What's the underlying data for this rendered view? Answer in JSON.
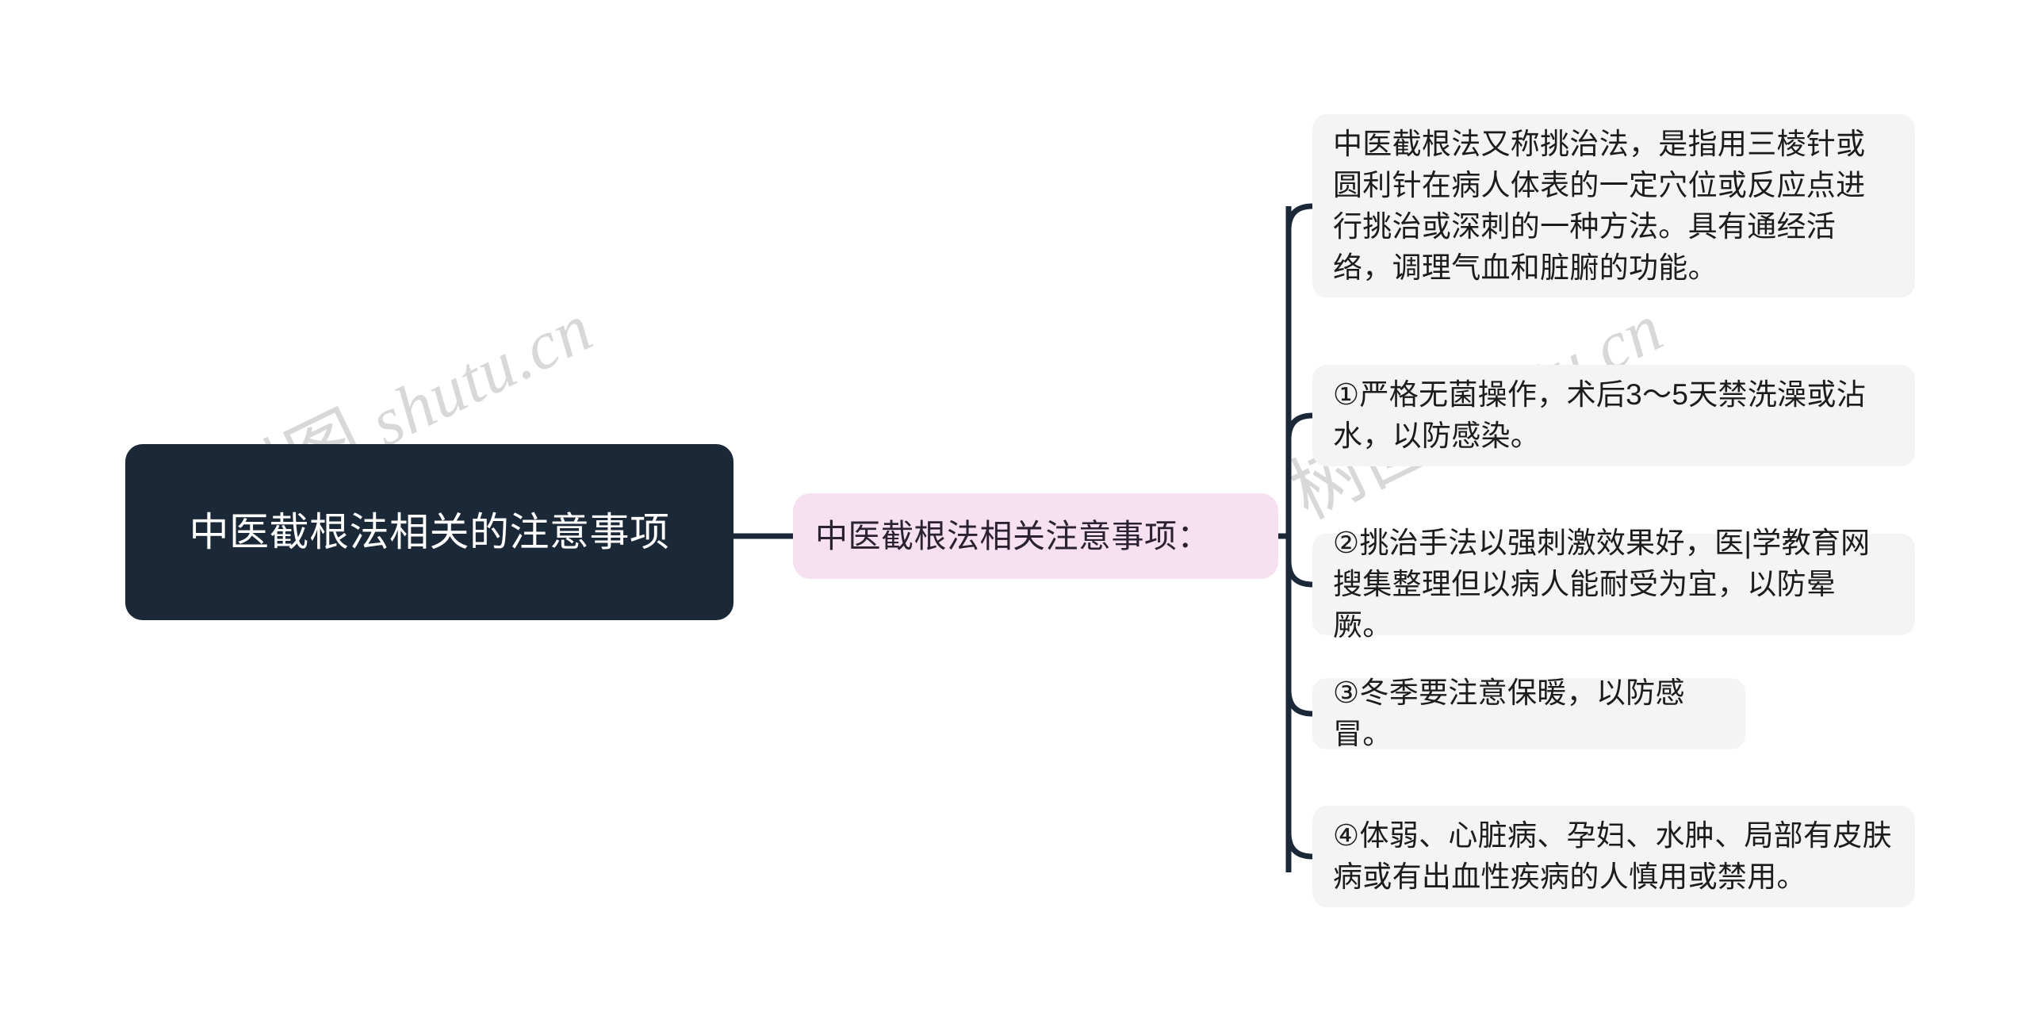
{
  "diagram": {
    "type": "mindmap",
    "orientation": "left-to-right",
    "colors": {
      "root_background": "#1b2838",
      "root_text": "#ffffff",
      "branch_background": "#f7e1f0",
      "branch_text": "#2a2230",
      "leaf_background": "#f4f4f4",
      "leaf_text": "#1c1c1c",
      "connector_line": "#1b2838",
      "page_background": "#ffffff",
      "watermark": "#d8d8da"
    }
  },
  "root": {
    "label": "中医截根法相关的注意事项"
  },
  "branch": {
    "label": "中医截根法相关注意事项："
  },
  "leaves": [
    {
      "label": "中医截根法又称挑治法，是指用三棱针或圆利针在病人体表的一定穴位或反应点进行挑治或深刺的一种方法。具有通经活络，调理气血和脏腑的功能。"
    },
    {
      "label": "①严格无菌操作，术后3～5天禁洗澡或沾水，以防感染。"
    },
    {
      "label": "②挑治手法以强刺激效果好，医|学教育网搜集整理但以病人能耐受为宜，以防晕厥。"
    },
    {
      "label": "③冬季要注意保暖，以防感冒。"
    },
    {
      "label": "④体弱、心脏病、孕妇、水肿、局部有皮肤病或有出血性疾病的人慎用或禁用。"
    }
  ],
  "watermark": {
    "cjk": "树图",
    "latin": " shutu.cn"
  }
}
